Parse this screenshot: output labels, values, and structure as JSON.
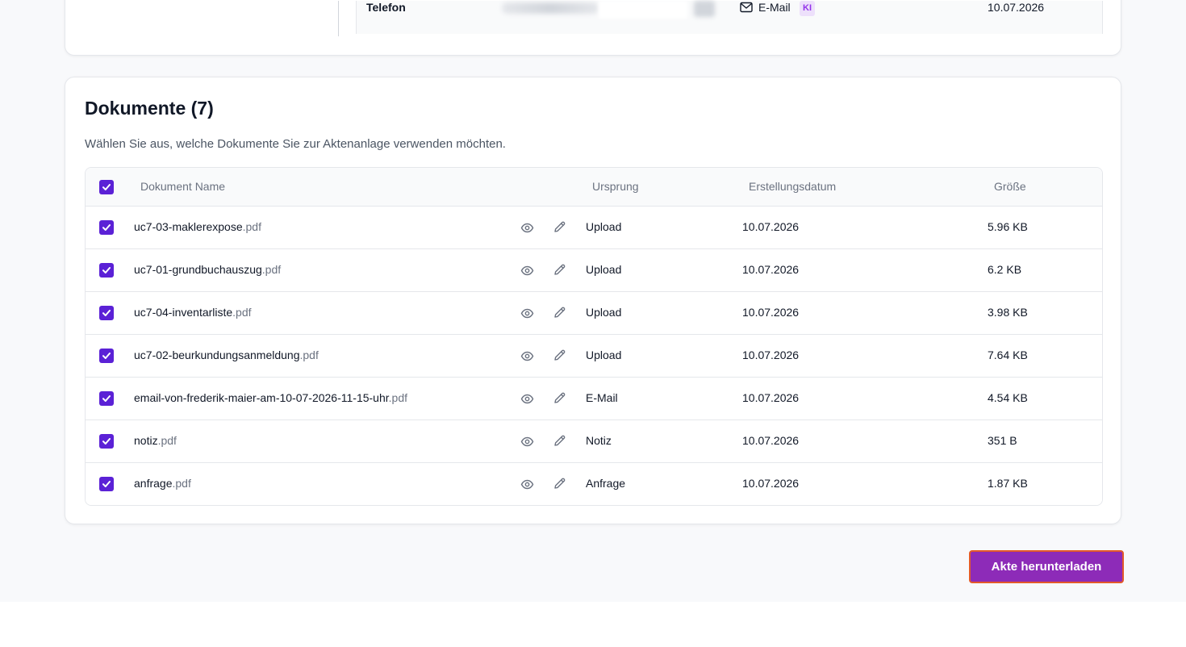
{
  "contact": {
    "label": "Telefon",
    "channel": "E-Mail",
    "badge": "KI",
    "date": "10.07.2026"
  },
  "documents": {
    "title": "Dokumente (7)",
    "subtitle": "Wählen Sie aus, welche Dokumente Sie zur Aktenanlage verwenden möchten.",
    "columns": {
      "name": "Dokument Name",
      "origin": "Ursprung",
      "date": "Erstellungsdatum",
      "size": "Größe"
    },
    "rows": [
      {
        "name": "uc7-03-maklerexpose",
        "ext": ".pdf",
        "origin": "Upload",
        "date": "10.07.2026",
        "size": "5.96 KB"
      },
      {
        "name": "uc7-01-grundbuchauszug",
        "ext": ".pdf",
        "origin": "Upload",
        "date": "10.07.2026",
        "size": "6.2 KB"
      },
      {
        "name": "uc7-04-inventarliste",
        "ext": ".pdf",
        "origin": "Upload",
        "date": "10.07.2026",
        "size": "3.98 KB"
      },
      {
        "name": "uc7-02-beurkundungsanmeldung",
        "ext": ".pdf",
        "origin": "Upload",
        "date": "10.07.2026",
        "size": "7.64 KB"
      },
      {
        "name": "email-von-frederik-maier-am-10-07-2026-11-15-uhr",
        "ext": ".pdf",
        "origin": "E-Mail",
        "date": "10.07.2026",
        "size": "4.54 KB"
      },
      {
        "name": "notiz",
        "ext": ".pdf",
        "origin": "Notiz",
        "date": "10.07.2026",
        "size": "351 B"
      },
      {
        "name": "anfrage",
        "ext": ".pdf",
        "origin": "Anfrage",
        "date": "10.07.2026",
        "size": "1.87 KB"
      }
    ]
  },
  "actions": {
    "download_label": "Akte herunterladen"
  },
  "colors": {
    "accent": "#5b21d6",
    "button": "#8d2bb8",
    "badge_bg": "#ede0fb"
  },
  "icons": {
    "view": "eye-icon",
    "edit": "pencil-icon",
    "channel": "mail-icon",
    "check": "check-icon"
  }
}
